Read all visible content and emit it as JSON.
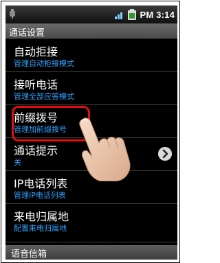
{
  "status": {
    "time": "PM 3:14"
  },
  "header": {
    "title": "通话设置"
  },
  "settings": [
    {
      "label": "自动拒接",
      "sub": "管理自动拒接模式"
    },
    {
      "label": "接听电话",
      "sub": "管理全部应答模式"
    },
    {
      "label": "前缀拨号",
      "sub": "管理加前缀拨号"
    },
    {
      "label": "通话提示",
      "sub": "关"
    },
    {
      "label": "IP电话列表",
      "sub": "管理IP电话列表"
    },
    {
      "label": "来电归属地",
      "sub": "配置来电归属地"
    }
  ],
  "footer": {
    "section_label": "语音信箱"
  },
  "colors": {
    "accent_subtext": "#2ea3ff",
    "highlight": "#e01010"
  },
  "icons": [
    "usb-icon",
    "signal-icon",
    "battery-icon",
    "chevron-right-icon",
    "pointing-hand-icon"
  ]
}
